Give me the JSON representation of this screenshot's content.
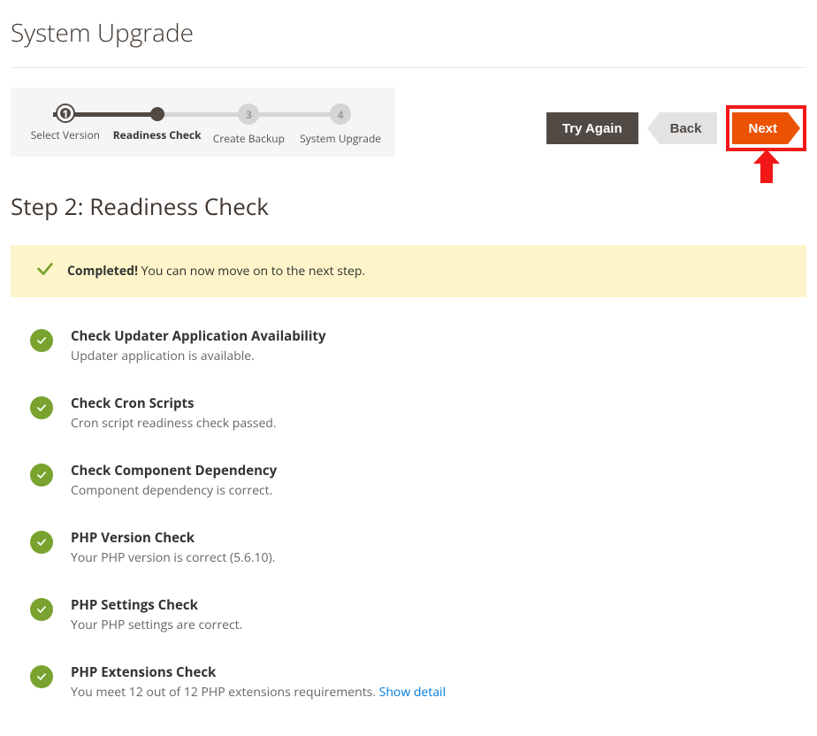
{
  "page_title": "System Upgrade",
  "progress": {
    "steps": [
      {
        "num": "1",
        "label": "Select Version",
        "state": "done"
      },
      {
        "num": "",
        "label": "Readiness Check",
        "state": "current"
      },
      {
        "num": "3",
        "label": "Create Backup",
        "state": "future"
      },
      {
        "num": "4",
        "label": "System Upgrade",
        "state": "future"
      }
    ]
  },
  "nav": {
    "try_again": "Try Again",
    "back": "Back",
    "next": "Next"
  },
  "step_heading": "Step 2: Readiness Check",
  "alert": {
    "strong": "Completed!",
    "rest": " You can now move on to the next step."
  },
  "checks": [
    {
      "title": "Check Updater Application Availability",
      "detail": "Updater application is available."
    },
    {
      "title": "Check Cron Scripts",
      "detail": "Cron script readiness check passed."
    },
    {
      "title": "Check Component Dependency",
      "detail": "Component dependency is correct."
    },
    {
      "title": "PHP Version Check",
      "detail": "Your PHP version is correct (5.6.10)."
    },
    {
      "title": "PHP Settings Check",
      "detail": "Your PHP settings are correct."
    },
    {
      "title": "PHP Extensions Check",
      "detail": "You meet 12 out of 12 PHP extensions requirements. ",
      "link": "Show detail"
    }
  ]
}
